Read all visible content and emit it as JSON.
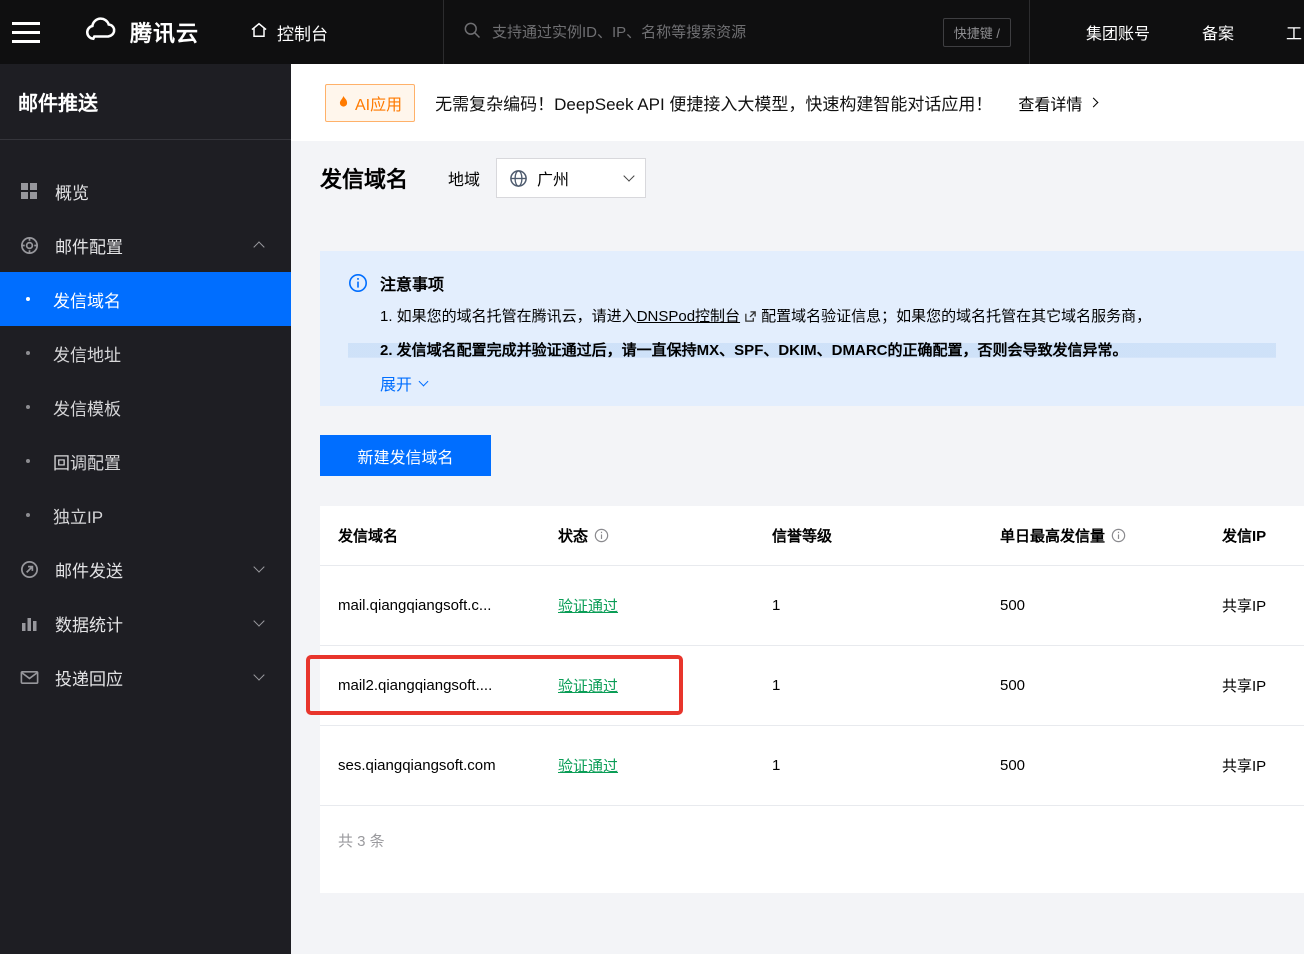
{
  "topbar": {
    "brand": "腾讯云",
    "console": "控制台",
    "search_placeholder": "支持通过实例ID、IP、名称等搜索资源",
    "shortcut_badge": "快捷键 /",
    "nav": [
      "集团账号",
      "备案",
      "工"
    ]
  },
  "sidebar": {
    "title": "邮件推送",
    "items": {
      "overview": "概览",
      "mail_config": "邮件配置",
      "mail_send": "邮件发送",
      "data_stats": "数据统计",
      "delivery_reply": "投递回应"
    },
    "sub_items": [
      "发信域名",
      "发信地址",
      "发信模板",
      "回调配置",
      "独立IP"
    ],
    "active_item": "发信域名"
  },
  "banner": {
    "badge": "AI应用",
    "message": "无需复杂编码！DeepSeek API 便捷接入大模型，快速构建智能对话应用！",
    "link": "查看详情"
  },
  "page": {
    "title": "发信域名",
    "region_label": "地域",
    "region_value": "广州"
  },
  "notice": {
    "title": "注意事项",
    "line1_prefix": "1. 如果您的域名托管在腾讯云，请进入",
    "line1_link": "DNSPod控制台",
    "line1_suffix": "配置域名验证信息；如果您的域名托管在其它域名服务商，",
    "line2": "2. 发信域名配置完成并验证通过后，请一直保持MX、SPF、DKIM、DMARC的正确配置，否则会导致发信异常。",
    "expand": "展开"
  },
  "create_button": "新建发信域名",
  "table": {
    "headers": [
      "发信域名",
      "状态",
      "信誉等级",
      "单日最高发信量",
      "发信IP"
    ],
    "rows": [
      {
        "domain": "mail.qiangqiangsoft.c...",
        "status": "验证通过",
        "reputation": "1",
        "daily_limit": "500",
        "ip_type": "共享IP"
      },
      {
        "domain": "mail2.qiangqiangsoft....",
        "status": "验证通过",
        "reputation": "1",
        "daily_limit": "500",
        "ip_type": "共享IP"
      },
      {
        "domain": "ses.qiangqiangsoft.com",
        "status": "验证通过",
        "reputation": "1",
        "daily_limit": "500",
        "ip_type": "共享IP"
      }
    ],
    "total": "共 3 条"
  },
  "colors": {
    "accent_blue": "#006eff",
    "success_green": "#0a9d56",
    "annotation_red": "#e8352c",
    "badge_orange": "#ff7a00",
    "notice_bg": "#e3eefd",
    "topbar_bg": "#0f0f10",
    "sidebar_bg": "#1e1e23"
  }
}
